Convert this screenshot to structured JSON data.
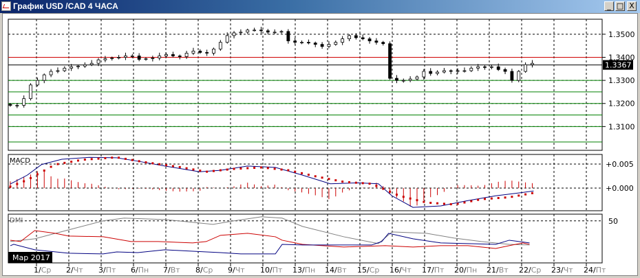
{
  "window": {
    "title": "График USD /CAD  4 ЧАСА",
    "minimize_label": "_",
    "maximize_label": "□",
    "close_label": "X"
  },
  "colors": {
    "accent": "#0a246a",
    "support": "#008000",
    "resistance": "#d00000",
    "macd": "#000080",
    "signal": "#cc0000",
    "adx": "#808080"
  },
  "chart_data": [
    {
      "type": "candlestick",
      "title": "USD/CAD 4H",
      "ylim": [
        1.2997,
        1.3565
      ],
      "yticks": [
        "1.3500",
        "1.3400",
        "1.3300",
        "1.3200",
        "1.3100"
      ],
      "ytick_values": [
        1.35,
        1.34,
        1.33,
        1.32,
        1.31
      ],
      "current_price_label": "1.3367",
      "current_price": 1.3367,
      "resistance_levels": [
        1.34
      ],
      "support_levels": [
        1.33,
        1.325,
        1.32,
        1.315,
        1.31,
        1.3033
      ],
      "closes": [
        1.3192,
        1.3192,
        1.3221,
        1.328,
        1.33,
        1.3324,
        1.3339,
        1.3342,
        1.3353,
        1.3359,
        1.3362,
        1.3368,
        1.3374,
        1.3389,
        1.3394,
        1.3397,
        1.34,
        1.3406,
        1.3406,
        1.3391,
        1.3394,
        1.3397,
        1.3406,
        1.3412,
        1.3406,
        1.3403,
        1.3418,
        1.3427,
        1.3421,
        1.3418,
        1.3436,
        1.3465,
        1.3494,
        1.3506,
        1.3509,
        1.3518,
        1.3518,
        1.3515,
        1.3509,
        1.3509,
        1.3512,
        1.3471,
        1.3465,
        1.3465,
        1.3462,
        1.3456,
        1.3447,
        1.3456,
        1.3465,
        1.348,
        1.3494,
        1.3485,
        1.348,
        1.3471,
        1.3465,
        1.3459,
        1.3309,
        1.33,
        1.33,
        1.3306,
        1.3315,
        1.3339,
        1.333,
        1.3336,
        1.3342,
        1.3339,
        1.3342,
        1.3342,
        1.3353,
        1.3359,
        1.3356,
        1.3359,
        1.3347,
        1.3339,
        1.33,
        1.3339,
        1.3368,
        1.3374
      ]
    },
    {
      "type": "line",
      "title": "MACD",
      "ylim": [
        -0.0047,
        0.007
      ],
      "yticks": [
        "+0.005",
        "+0.000"
      ],
      "ytick_values": [
        0.005,
        0.0
      ],
      "macd": {
        "x": [
          0,
          2.5,
          4.6,
          7.6,
          11.7,
          15.7,
          18.8,
          22.8,
          27.9,
          31,
          35,
          39.1,
          43.1,
          47.2,
          51.3,
          54.3,
          56.3,
          59.4,
          63.5,
          67.5,
          71.6,
          75.6,
          77.2
        ],
        "y": [
          0.00086,
          0.0027,
          0.0049,
          0.006,
          0.0064,
          0.0063,
          0.0056,
          0.0046,
          0.0034,
          0.0037,
          0.0046,
          0.0043,
          0.0027,
          0.0009,
          0.0011,
          0.0009,
          -0.0016,
          -0.004,
          -0.0037,
          -0.0026,
          -0.0016,
          -0.0009,
          -0.0006
        ]
      },
      "signal": {
        "x": [
          0,
          2.5,
          6.6,
          10.7,
          15.7,
          19.8,
          24.9,
          28.9,
          33,
          37.1,
          41.1,
          45.2,
          49.2,
          53.3,
          57.4,
          61.4,
          65.5,
          69.5,
          73.6,
          77.2
        ],
        "y": [
          0.0003,
          0.0017,
          0.0049,
          0.0059,
          0.0064,
          0.0054,
          0.0044,
          0.0034,
          0.004,
          0.0043,
          0.0037,
          0.0024,
          0.0013,
          0.0009,
          -0.0016,
          -0.003,
          -0.0034,
          -0.0023,
          -0.0019,
          -0.001
        ]
      }
    },
    {
      "type": "line",
      "title": "DMI",
      "ylim": [
        0,
        58
      ],
      "yticks": [
        "50"
      ],
      "ytick_values": [
        50
      ],
      "adx": {
        "x": [
          0,
          3.6,
          8.6,
          13.7,
          16.8,
          22.8,
          27.9,
          29.9,
          33,
          37.1,
          40.1,
          43.1,
          49.2,
          54.3,
          56.3,
          61.4,
          65.5,
          69.5,
          73.6,
          76.6
        ],
        "y": [
          25.4,
          28.7,
          39.3,
          50,
          53.3,
          51.6,
          47.5,
          45.9,
          50,
          54.9,
          53.3,
          43.4,
          31.1,
          23,
          36.9,
          35.2,
          29.5,
          25.4,
          22.1,
          21.3
        ]
      },
      "plus_di": {
        "x": [
          0,
          1.5,
          3.6,
          6.6,
          8.6,
          13.7,
          17.8,
          21.8,
          26.9,
          28.9,
          31,
          35,
          39.1,
          40.1,
          43.1,
          49.2,
          55.3,
          59.4,
          63.5,
          67.5,
          71.6,
          73.6,
          75.6,
          76.6
        ],
        "y": [
          27,
          25.4,
          38.5,
          35.2,
          32,
          31.1,
          25.4,
          25.4,
          23.8,
          25.4,
          32.8,
          35.2,
          31.1,
          27,
          22.1,
          18.9,
          20.5,
          18.9,
          20.5,
          20.5,
          17.2,
          20.5,
          23.8,
          22.1
        ]
      },
      "minus_di": {
        "x": [
          0,
          0.5,
          3.6,
          8.6,
          13.7,
          15.7,
          18.8,
          22.8,
          26.9,
          31,
          34,
          39.1,
          40.1,
          43.1,
          47.2,
          53.3,
          54.8,
          55.8,
          59.4,
          63.5,
          67.5,
          71.6,
          73.6,
          76.6
        ],
        "y": [
          20.5,
          22.1,
          15.6,
          11.5,
          10.7,
          13.1,
          12.3,
          15.6,
          13.9,
          12.3,
          10.7,
          10.7,
          22.1,
          21.3,
          21.3,
          21.3,
          25.4,
          35.2,
          28.7,
          23.8,
          23,
          22.1,
          27,
          23.8
        ]
      }
    }
  ],
  "month_label": "Мар 2017",
  "dates": [
    {
      "day": "1/",
      "wd": "Ср"
    },
    {
      "day": "2/",
      "wd": "Чт"
    },
    {
      "day": "3/",
      "wd": "Пт"
    },
    {
      "day": "6/",
      "wd": "Пн"
    },
    {
      "day": "7/",
      "wd": "Вт"
    },
    {
      "day": "8/",
      "wd": "Ср"
    },
    {
      "day": "9/",
      "wd": "Чт"
    },
    {
      "day": "10/",
      "wd": "Пт"
    },
    {
      "day": "13/",
      "wd": "Пн"
    },
    {
      "day": "14/",
      "wd": "Вт"
    },
    {
      "day": "15/",
      "wd": "Ср"
    },
    {
      "day": "16/",
      "wd": "Чт"
    },
    {
      "day": "17/",
      "wd": "Пт"
    },
    {
      "day": "20/",
      "wd": "Пн"
    },
    {
      "day": "21/",
      "wd": "Вт"
    },
    {
      "day": "22/",
      "wd": "Ср"
    },
    {
      "day": "23/",
      "wd": "Чт"
    },
    {
      "day": "24/",
      "wd": "Пт"
    }
  ]
}
